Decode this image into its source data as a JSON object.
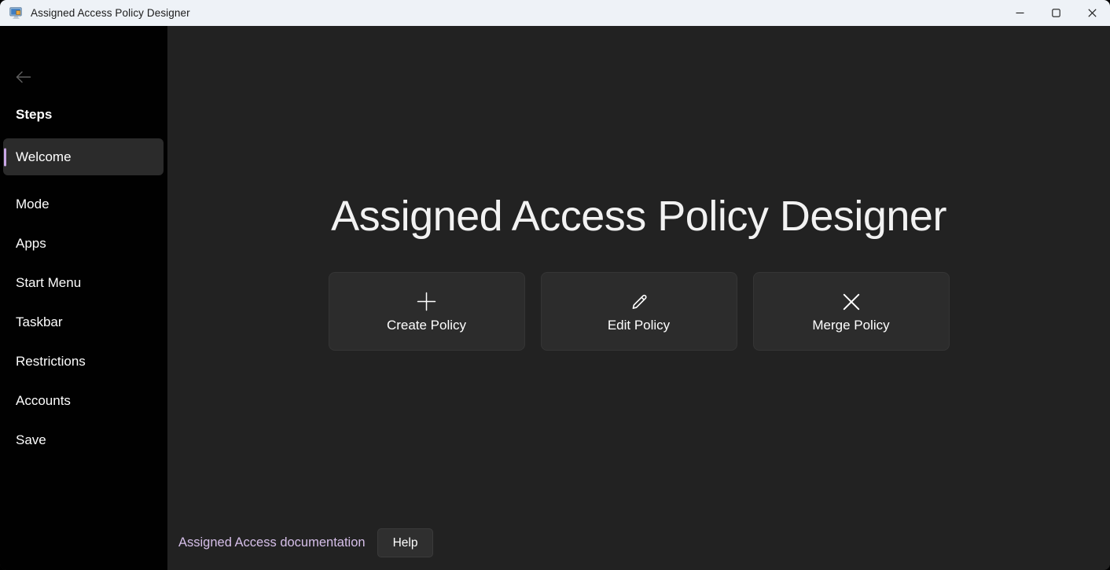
{
  "window": {
    "title": "Assigned Access Policy Designer",
    "icons": {
      "app": "computer-monitor-icon",
      "minimize": "minimize-icon",
      "maximize": "maximize-icon",
      "close": "close-icon"
    }
  },
  "sidebar": {
    "back_icon": "back-arrow-icon",
    "heading": "Steps",
    "items": [
      {
        "label": "Welcome",
        "selected": true
      },
      {
        "label": "Mode",
        "selected": false
      },
      {
        "label": "Apps",
        "selected": false
      },
      {
        "label": "Start Menu",
        "selected": false
      },
      {
        "label": "Taskbar",
        "selected": false
      },
      {
        "label": "Restrictions",
        "selected": false
      },
      {
        "label": "Accounts",
        "selected": false
      },
      {
        "label": "Save",
        "selected": false
      }
    ]
  },
  "main": {
    "title": "Assigned Access Policy Designer",
    "cards": [
      {
        "label": "Create Policy",
        "icon": "plus-icon"
      },
      {
        "label": "Edit Policy",
        "icon": "pencil-icon"
      },
      {
        "label": "Merge Policy",
        "icon": "merge-cross-icon"
      }
    ],
    "footer": {
      "link_label": "Assigned Access documentation",
      "help_label": "Help"
    }
  },
  "colors": {
    "accent": "#c9a7e6",
    "link": "#d6bfe9",
    "titlebar_bg": "#eef2f7",
    "sidebar_bg": "#010101",
    "content_bg": "#222222",
    "card_bg": "#2c2c2c"
  }
}
